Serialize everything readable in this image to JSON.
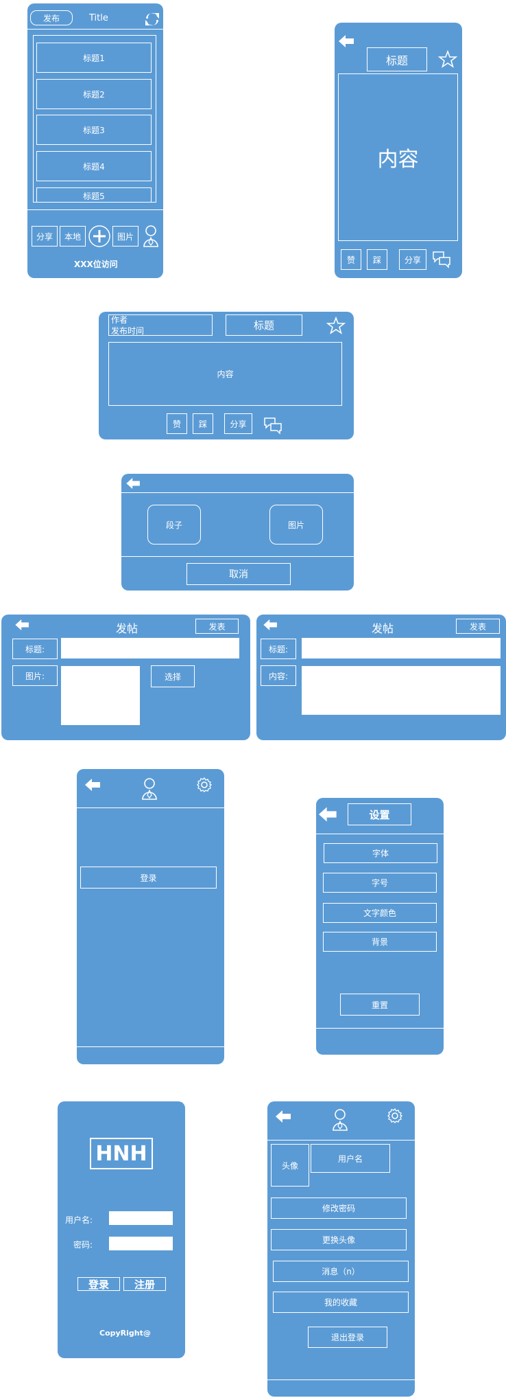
{
  "screen1": {
    "publish": "发布",
    "title": "Title",
    "items": [
      "标题1",
      "标题2",
      "标题3",
      "标题4",
      "标题5"
    ],
    "buttons": [
      "分享",
      "本地",
      "图片"
    ],
    "visits": "XXX位访问"
  },
  "screen2": {
    "title": "标题",
    "content": "内容",
    "like": "赞",
    "dislike": "踩",
    "share": "分享"
  },
  "screen3": {
    "author": "作者",
    "time": "发布时间",
    "title": "标题",
    "content": "内容",
    "like": "赞",
    "dislike": "踩",
    "share": "分享"
  },
  "screen4": {
    "joke": "段子",
    "image": "图片",
    "cancel": "取消"
  },
  "screen5": {
    "title": "发帖",
    "submit": "发表",
    "title_label": "标题:",
    "image_label": "图片:",
    "choose": "选择"
  },
  "screen6": {
    "title": "发帖",
    "submit": "发表",
    "title_label": "标题:",
    "content_label": "内容:"
  },
  "screen7": {
    "login": "登录"
  },
  "screen8": {
    "title": "设置",
    "items": [
      "字体",
      "字号",
      "文字颜色",
      "背景"
    ],
    "reset": "重置"
  },
  "screen9": {
    "logo": "HNH",
    "username_label": "用户名:",
    "password_label": "密码:",
    "login": "登录",
    "register": "注册",
    "copyright": "CopyRight@"
  },
  "screen10": {
    "avatar": "头像",
    "username": "用户名",
    "items": [
      "修改密码",
      "更换头像",
      "消息（n）",
      "我的收藏"
    ],
    "logout": "退出登录"
  }
}
